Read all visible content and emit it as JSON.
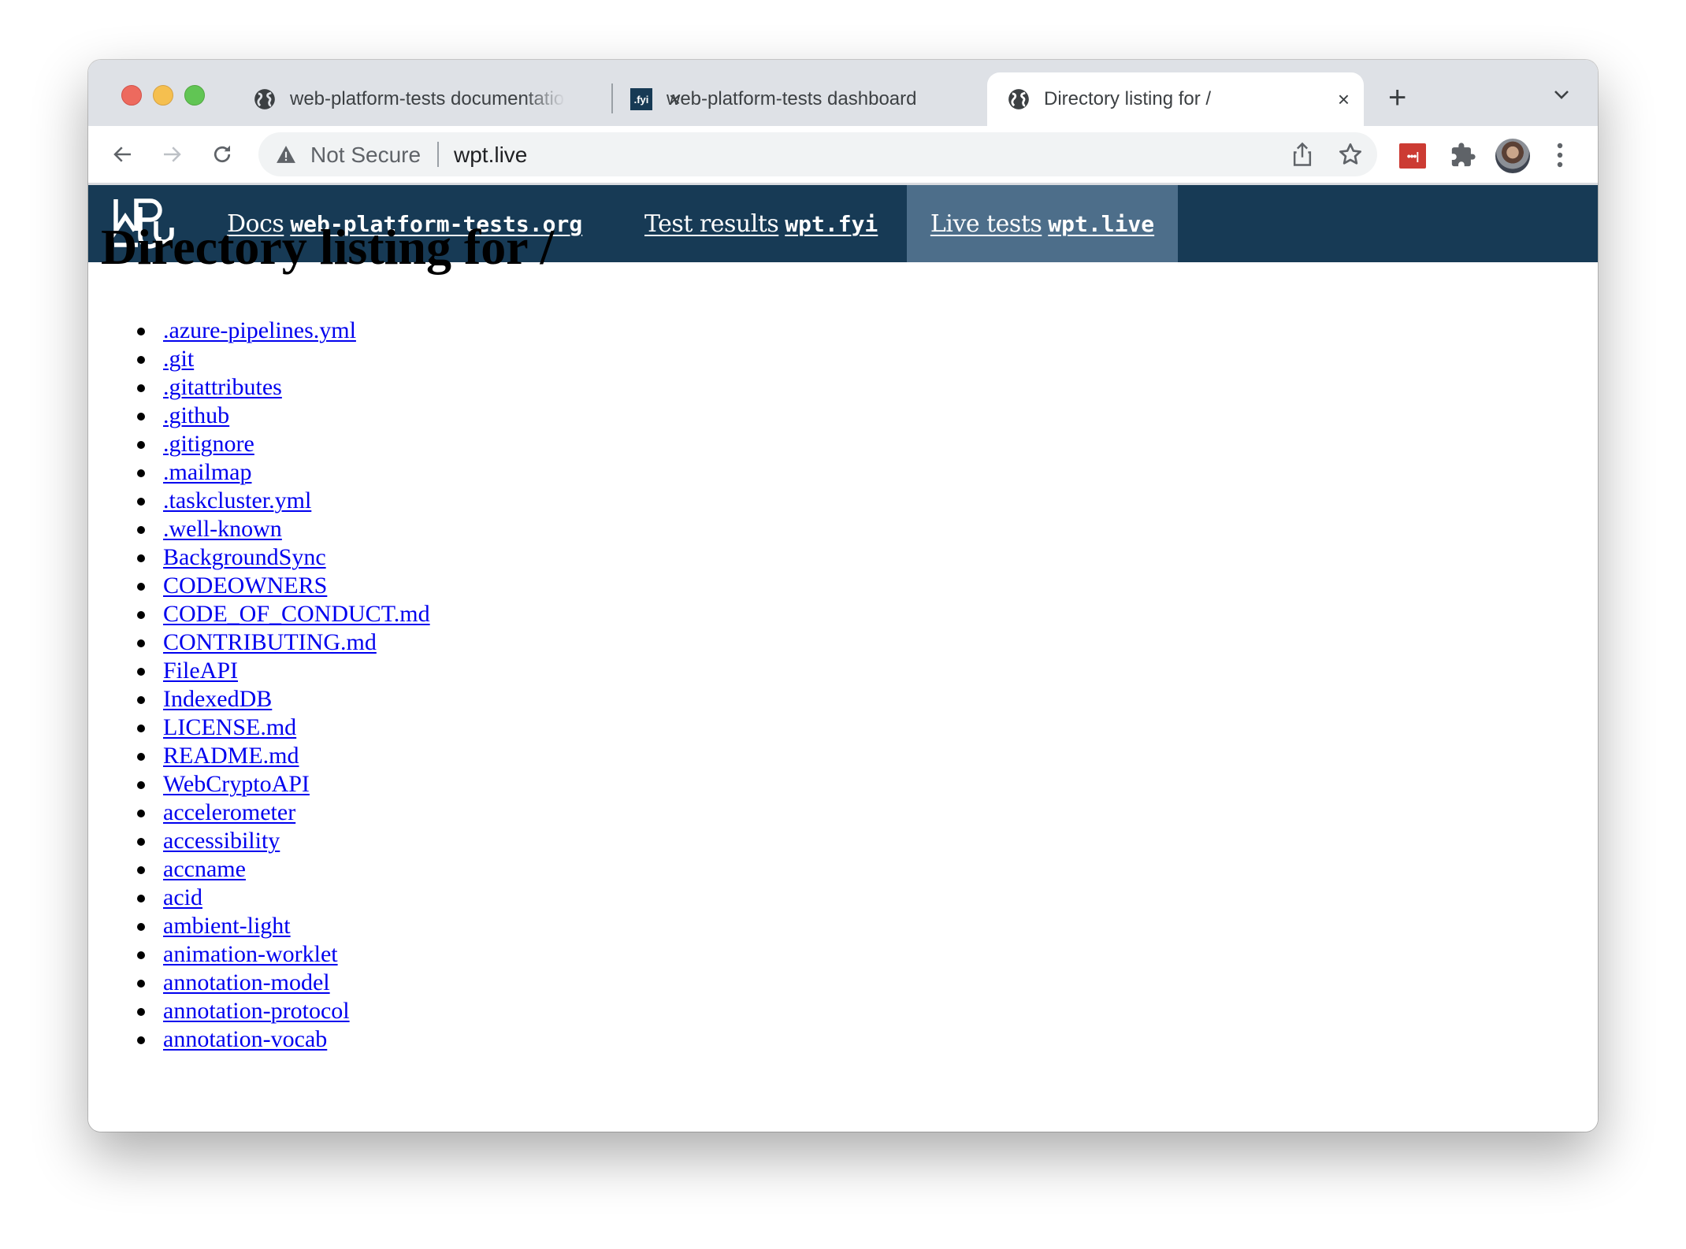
{
  "browser": {
    "tabs": [
      {
        "title": "web-platform-tests documentation",
        "favicon": "globe-icon",
        "active": false
      },
      {
        "title": "web-platform-tests dashboard",
        "favicon": "fyi-icon",
        "favicon_text": ".fyi",
        "active": false
      },
      {
        "title": "Directory listing for /",
        "favicon": "globe-icon",
        "active": true
      }
    ],
    "new_tab_label": "+",
    "close_label": "×",
    "address": {
      "security_label": "Not Secure",
      "url": "wpt.live"
    },
    "extension_label": "•••|"
  },
  "nav": {
    "links": [
      {
        "label": "Docs",
        "domain": "web-platform-tests.org",
        "active": false
      },
      {
        "label": "Test results",
        "domain": "wpt.fyi",
        "active": false
      },
      {
        "label": "Live tests",
        "domain": "wpt.live",
        "active": true
      }
    ],
    "colors": {
      "bar": "#173a55",
      "active": "#4d6e8a"
    }
  },
  "page": {
    "heading": "Directory listing for /",
    "entries": [
      ".azure-pipelines.yml",
      ".git",
      ".gitattributes",
      ".github",
      ".gitignore",
      ".mailmap",
      ".taskcluster.yml",
      ".well-known",
      "BackgroundSync",
      "CODEOWNERS",
      "CODE_OF_CONDUCT.md",
      "CONTRIBUTING.md",
      "FileAPI",
      "IndexedDB",
      "LICENSE.md",
      "README.md",
      "WebCryptoAPI",
      "accelerometer",
      "accessibility",
      "accname",
      "acid",
      "ambient-light",
      "animation-worklet",
      "annotation-model",
      "annotation-protocol",
      "annotation-vocab"
    ]
  }
}
